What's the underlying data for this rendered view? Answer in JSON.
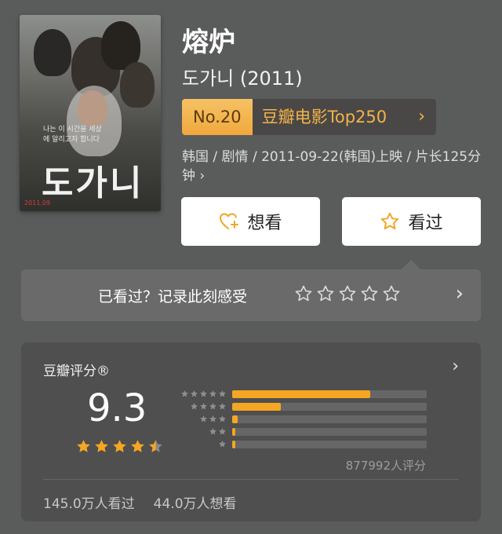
{
  "movie": {
    "title": "熔炉",
    "original_title": "도가니 (2011)",
    "rank": {
      "number": "No.20",
      "list": "豆瓣电影Top250",
      "arrow": "›"
    },
    "meta": "韩国 / 剧情 / 2011-09-22(韩国)上映 / 片长125分钟 ›",
    "poster": {
      "title": "도가니",
      "tagline": "나는 이 시간을 세상에 알리고자 합니다",
      "date": "2011.09"
    }
  },
  "actions": {
    "want_label": "想看",
    "watched_label": "看过"
  },
  "mark": {
    "prompt": "已看过？记录此刻感受",
    "arrow": "›"
  },
  "rating": {
    "header": "豆瓣评分®",
    "arrow": "›",
    "score": "9.3",
    "stars": 4.5,
    "distribution": [
      {
        "stars": 5,
        "fraction": 0.71
      },
      {
        "stars": 4,
        "fraction": 0.25
      },
      {
        "stars": 3,
        "fraction": 0.03
      },
      {
        "stars": 2,
        "fraction": 0.004
      },
      {
        "stars": 1,
        "fraction": 0.003
      }
    ],
    "count": "877992人评分",
    "watched": "145.0万人看过",
    "wishlist": "44.0万人想看"
  },
  "colors": {
    "accent": "#f5a623",
    "rank_bg": "#f0a83d",
    "background": "#5a5b5b"
  }
}
